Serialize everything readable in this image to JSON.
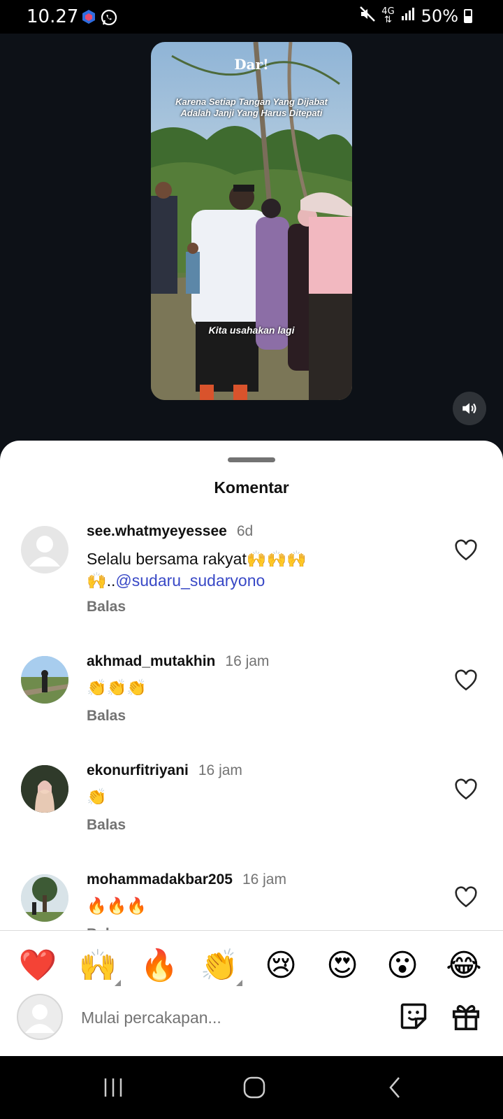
{
  "status_bar": {
    "time": "10.27",
    "network": "4G",
    "battery": "50%",
    "icons": [
      "app-notification-icon",
      "whatsapp-icon",
      "mute-icon",
      "network-4g-icon",
      "signal-icon",
      "battery-icon"
    ]
  },
  "video": {
    "brand": "Dar!",
    "caption": "Karena Setiap Tangan Yang Dijabat Adalah Janji Yang Harus Ditepati",
    "subtitle": "Kita usahakan lagi",
    "sound_icon": "speaker-on-icon"
  },
  "sheet": {
    "title": "Komentar"
  },
  "comments": [
    {
      "username": "see.whatmyeyessee",
      "time": "6d",
      "text": "Selalu bersama rakyat🙌🙌🙌🙌..",
      "mention": "@sudaru_sudaryono",
      "reply": "Balas"
    },
    {
      "username": "akhmad_mutakhin",
      "time": "16 jam",
      "text": "👏👏👏",
      "reply": "Balas"
    },
    {
      "username": "ekonurfitriyani",
      "time": "16 jam",
      "text": "👏",
      "reply": "Balas"
    },
    {
      "username": "mohammadakbar205",
      "time": "16 jam",
      "text": "🔥🔥🔥",
      "reply": "Balas"
    }
  ],
  "composer": {
    "emojis": [
      "❤️",
      "🙌",
      "🔥",
      "👏",
      "😢",
      "😍",
      "😮",
      "😂"
    ],
    "placeholder": "Mulai percakapan...",
    "sticker_icon": "sticker-icon",
    "gift_icon": "gift-icon"
  },
  "colors": {
    "mention": "#3848c6",
    "secondary_text": "#737373",
    "background_dark": "#0d1117"
  }
}
